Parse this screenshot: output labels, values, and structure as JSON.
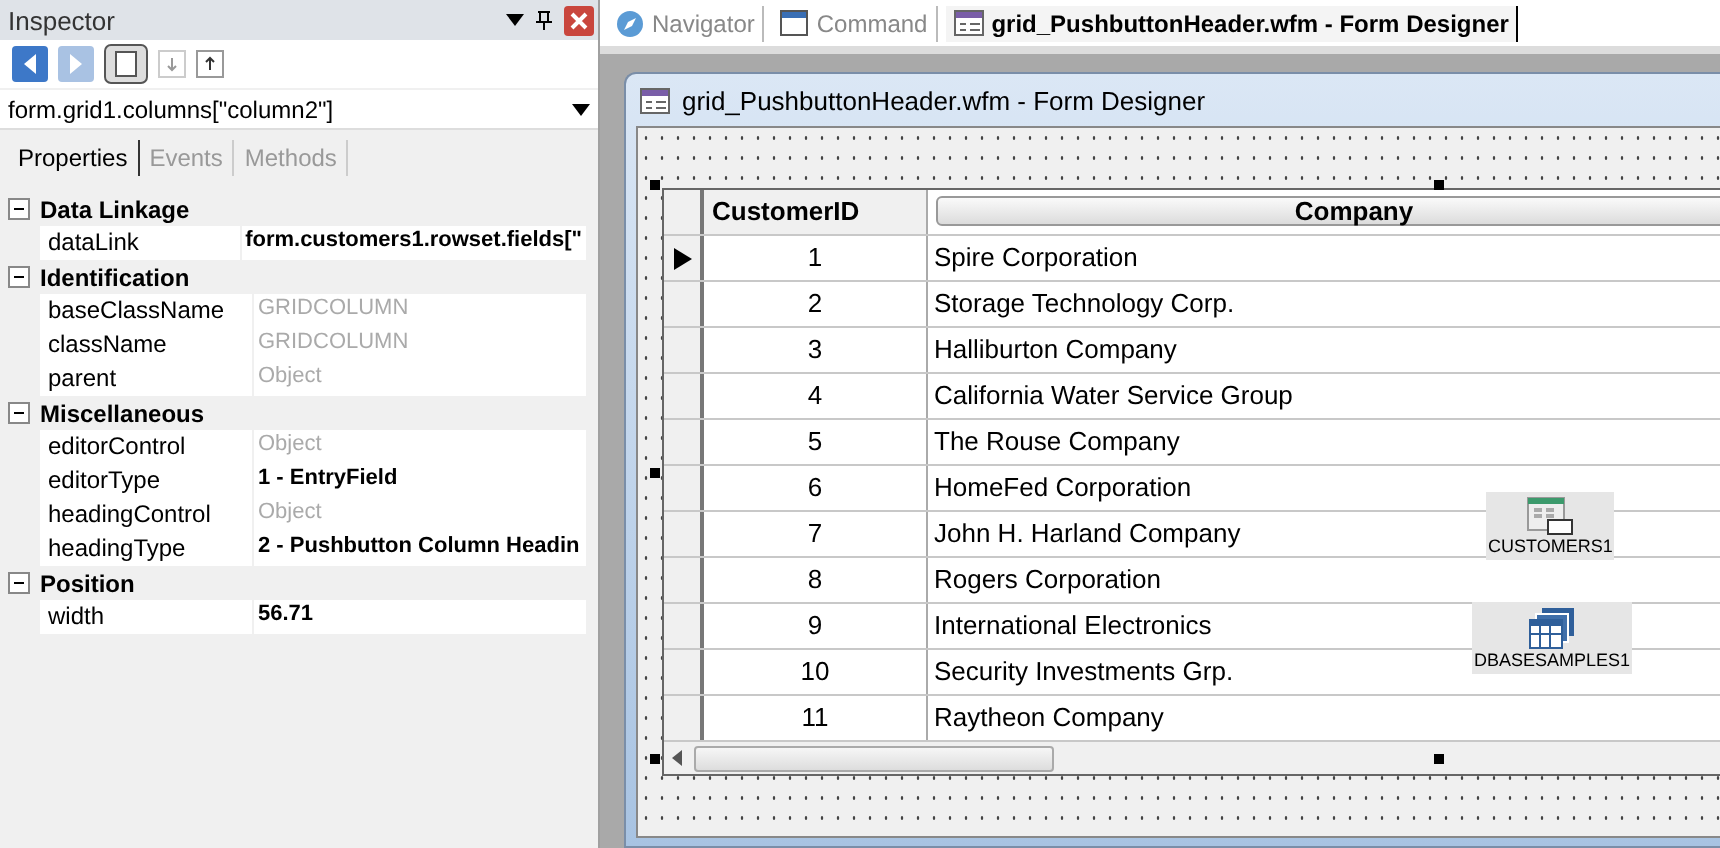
{
  "inspector": {
    "title": "Inspector",
    "object_selector": "form.grid1.columns[\"column2\"]",
    "tabs": [
      {
        "label": "Properties",
        "selected": true
      },
      {
        "label": "Events",
        "selected": false
      },
      {
        "label": "Methods",
        "selected": false
      }
    ],
    "groups": [
      {
        "name": "Data Linkage",
        "expanded": true,
        "properties": [
          {
            "name": "dataLink",
            "value": "form.customers1.rowset.fields[\"",
            "disabled": false
          }
        ]
      },
      {
        "name": "Identification",
        "expanded": true,
        "properties": [
          {
            "name": "baseClassName",
            "value": "GRIDCOLUMN",
            "disabled": true
          },
          {
            "name": "className",
            "value": "GRIDCOLUMN",
            "disabled": true
          },
          {
            "name": "parent",
            "value": "Object",
            "disabled": true
          }
        ]
      },
      {
        "name": "Miscellaneous",
        "expanded": true,
        "properties": [
          {
            "name": "editorControl",
            "value": "Object",
            "disabled": true
          },
          {
            "name": "editorType",
            "value": "1 - EntryField",
            "disabled": false
          },
          {
            "name": "headingControl",
            "value": "Object",
            "disabled": true
          },
          {
            "name": "headingType",
            "value": "2 - Pushbutton Column Headin",
            "disabled": false
          }
        ]
      },
      {
        "name": "Position",
        "expanded": true,
        "properties": [
          {
            "name": "width",
            "value": "56.71",
            "disabled": false
          }
        ]
      }
    ]
  },
  "document_tabs": [
    {
      "label": "Navigator",
      "kind": "navigator",
      "selected": false
    },
    {
      "label": "Command",
      "kind": "command",
      "selected": false
    },
    {
      "label": "grid_PushbuttonHeader.wfm - Form Designer",
      "kind": "form",
      "selected": true
    }
  ],
  "form_window": {
    "title": "grid_PushbuttonHeader.wfm - Form Designer",
    "grid": {
      "columns": [
        {
          "label": "CustomerID",
          "kind": "plain"
        },
        {
          "label": "Company",
          "kind": "pushbutton"
        }
      ],
      "rows": [
        {
          "id": "1",
          "company": "Spire Corporation",
          "current": true
        },
        {
          "id": "2",
          "company": "Storage Technology Corp.",
          "current": false
        },
        {
          "id": "3",
          "company": "Halliburton Company",
          "current": false
        },
        {
          "id": "4",
          "company": "California Water Service Group",
          "current": false
        },
        {
          "id": "5",
          "company": "The Rouse Company",
          "current": false
        },
        {
          "id": "6",
          "company": "HomeFed Corporation",
          "current": false
        },
        {
          "id": "7",
          "company": "John H. Harland Company",
          "current": false
        },
        {
          "id": "8",
          "company": "Rogers Corporation",
          "current": false
        },
        {
          "id": "9",
          "company": "International Electronics",
          "current": false
        },
        {
          "id": "10",
          "company": "Security Investments Grp.",
          "current": false
        },
        {
          "id": "11",
          "company": "Raytheon Company",
          "current": false
        }
      ]
    },
    "components": [
      {
        "label": "CUSTOMERS1",
        "kind": "sql"
      },
      {
        "label": "DBASESAMPLES1",
        "kind": "database"
      }
    ]
  }
}
